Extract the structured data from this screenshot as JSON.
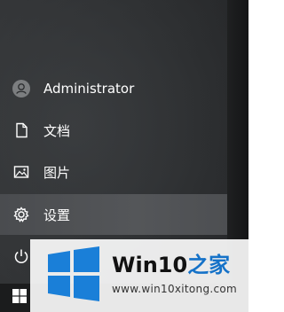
{
  "start_menu": {
    "items": {
      "user": {
        "label": "Administrator",
        "icon": "user-avatar-icon"
      },
      "documents": {
        "label": "文档",
        "icon": "document-icon"
      },
      "pictures": {
        "label": "图片",
        "icon": "picture-icon"
      },
      "settings": {
        "label": "设置",
        "icon": "gear-icon"
      },
      "power": {
        "icon": "power-icon"
      }
    },
    "start_icon": "windows-logo-icon",
    "colors": {
      "highlight": "#525457",
      "text": "#ffffff",
      "background": "#2b2d2f",
      "taskbar": "#1b1c1d"
    }
  },
  "watermark": {
    "title_main": "Win10",
    "title_suffix": "之家",
    "url": "www.win10xitong.com",
    "colors": {
      "logo_blue": "#1a7fd8",
      "suffix_blue": "#1572c8"
    }
  }
}
